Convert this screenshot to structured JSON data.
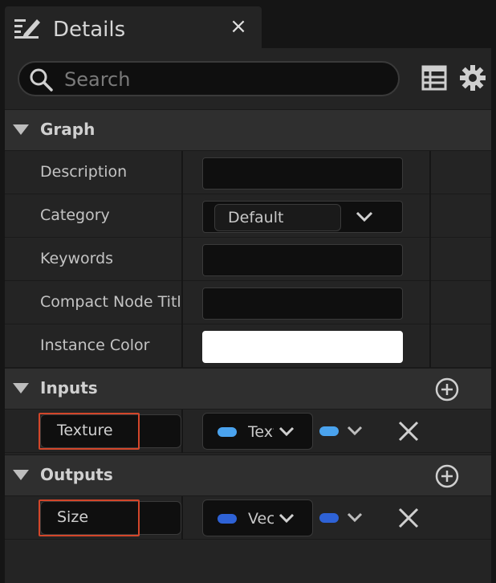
{
  "tab": {
    "title": "Details",
    "close_glyph": "×",
    "icon": "pencil-edit-icon"
  },
  "search": {
    "placeholder": "Search",
    "value": ""
  },
  "toolbar": {
    "view_options_icon": "table-icon",
    "settings_icon": "gear-icon"
  },
  "sections": {
    "graph": {
      "title": "Graph",
      "rows": [
        {
          "label": "Description",
          "kind": "text",
          "value": ""
        },
        {
          "label": "Category",
          "kind": "combo",
          "value": "Default"
        },
        {
          "label": "Keywords",
          "kind": "text",
          "value": ""
        },
        {
          "label": "Compact Node Title",
          "kind": "text",
          "value": ""
        },
        {
          "label": "Instance Color",
          "kind": "color",
          "value": "#ffffff"
        }
      ]
    },
    "inputs": {
      "title": "Inputs",
      "pins": [
        {
          "name": "Texture",
          "type": "Texture",
          "type_color": "#4aa3ee",
          "container_color": "#4aa3ee"
        }
      ]
    },
    "outputs": {
      "title": "Outputs",
      "pins": [
        {
          "name": "Size",
          "type": "Vector",
          "type_color": "#2e62d6",
          "container_color": "#2e62d6"
        }
      ]
    }
  },
  "colors": {
    "panel": "#242424",
    "section_header": "#2f2f2f",
    "highlight": "#d3462a"
  }
}
